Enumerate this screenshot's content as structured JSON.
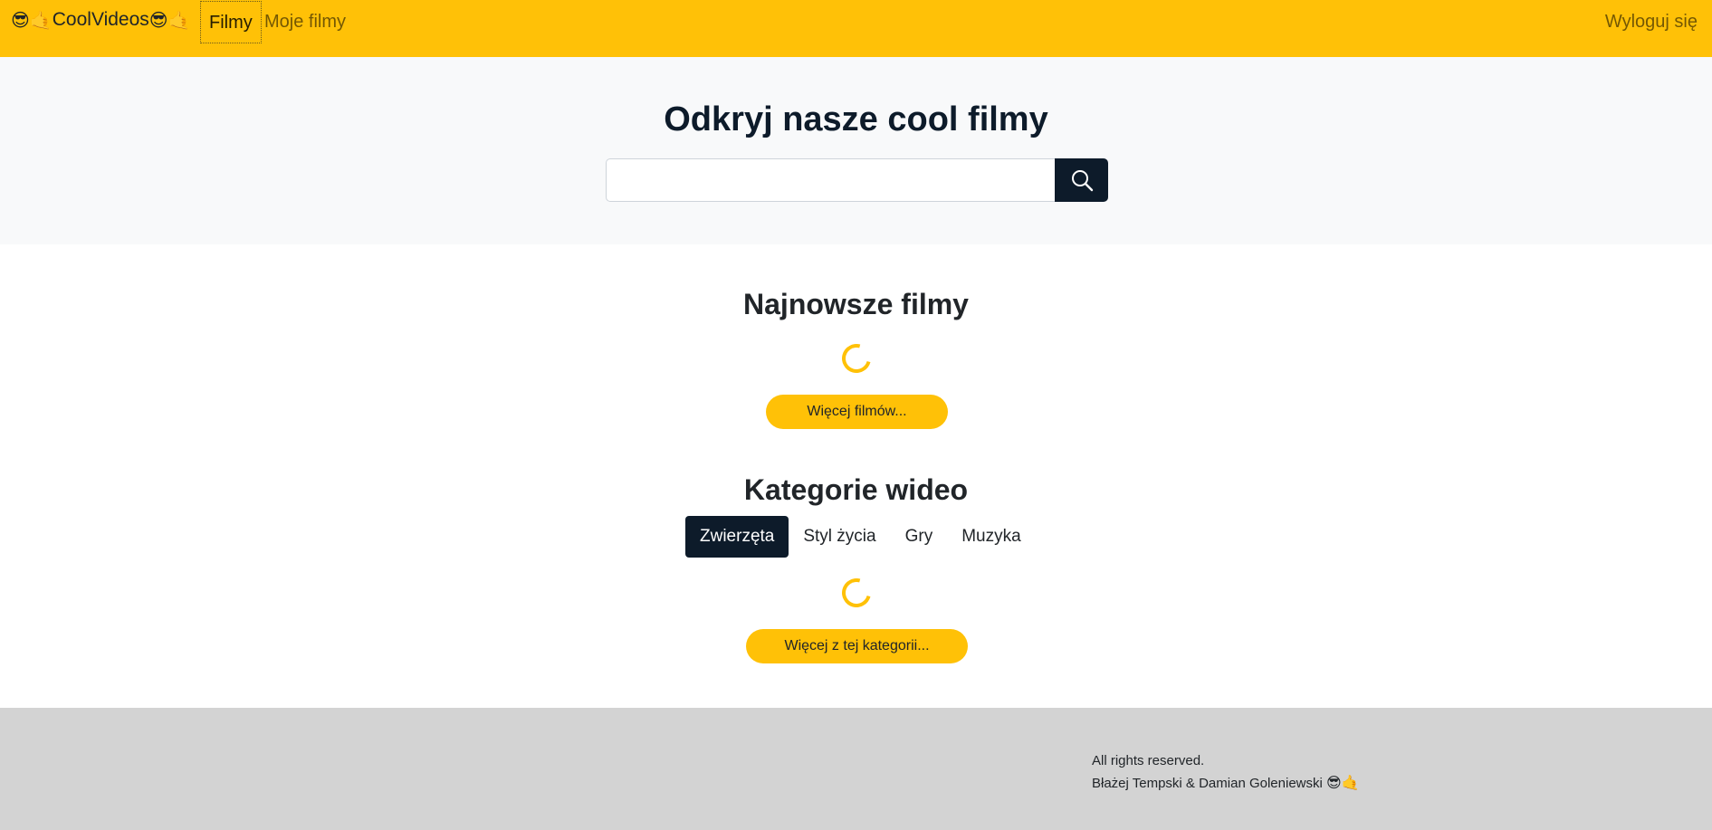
{
  "navbar": {
    "brand_emoji_left": "😎🤙",
    "brand_name": "CoolVideos",
    "brand_emoji_right": "😎🤙",
    "links": [
      {
        "label": "Filmy",
        "active": true
      },
      {
        "label": "Moje filmy",
        "active": false
      }
    ],
    "logout_label": "Wyloguj się"
  },
  "hero": {
    "title": "Odkryj nasze cool filmy",
    "search": {
      "value": "",
      "placeholder": "",
      "icon": "search-icon"
    }
  },
  "latest": {
    "title": "Najnowsze filmy",
    "loading": true,
    "more_label": "Więcej filmów..."
  },
  "categories": {
    "title": "Kategorie wideo",
    "tabs": [
      {
        "label": "Zwierzęta",
        "active": true
      },
      {
        "label": "Styl życia",
        "active": false
      },
      {
        "label": "Gry",
        "active": false
      },
      {
        "label": "Muzyka",
        "active": false
      }
    ],
    "loading": true,
    "more_label": "Więcej z tej kategorii..."
  },
  "footer": {
    "rights": "All rights reserved.",
    "authors": "Błażej Tempski & Damian Goleniewski",
    "authors_emoji": "😎🤙"
  },
  "colors": {
    "accent": "#ffc107",
    "dark": "#0d1b2a",
    "hero_bg": "#f8f9fa",
    "footer_bg": "#d3d3d3"
  }
}
